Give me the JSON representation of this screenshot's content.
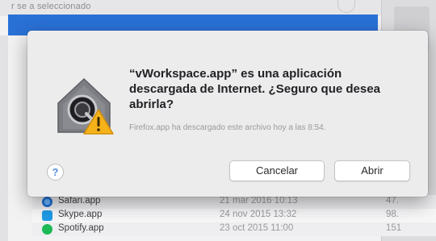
{
  "background": {
    "topbar_text": "r se a seleccionado",
    "files": [
      {
        "name": "Safari.app",
        "date": "21 mar 2016 10:13",
        "size": "47.",
        "icon": "safari-icon"
      },
      {
        "name": "Skype.app",
        "date": "24 nov 2015 13:32",
        "size": "98.",
        "icon": "skype-icon"
      },
      {
        "name": "Spotify.app",
        "date": "23 oct 2015 11:00",
        "size": "151",
        "icon": "spotify-icon"
      }
    ]
  },
  "dialog": {
    "icon": "gatekeeper-warning-icon",
    "title": "“vWorkspace.app” es una aplicación descargada de Internet. ¿Seguro que desea abrirla?",
    "body": "Firefox.app ha descargado este archivo hoy a las 8:54.",
    "help_label": "?",
    "cancel_label": "Cancelar",
    "open_label": "Abrir"
  },
  "colors": {
    "selection": "#2a71d6",
    "warning": "#f5b21a"
  }
}
